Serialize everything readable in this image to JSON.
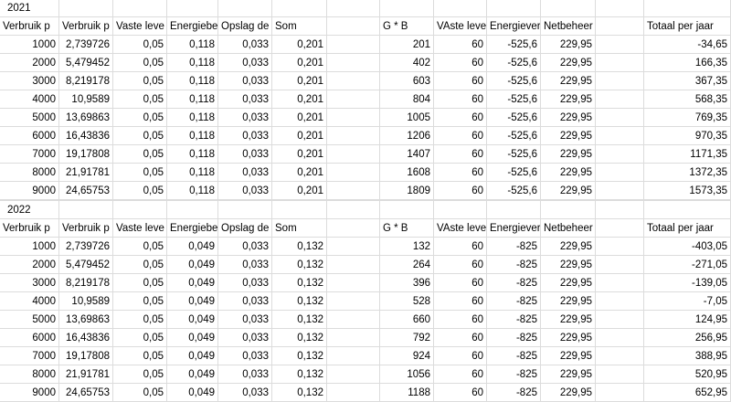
{
  "sections": [
    {
      "year": "2021",
      "headers": [
        "Verbruik p",
        "Verbruik p",
        "Vaste leve",
        "Energiebe",
        "Opslag de",
        "Som",
        "",
        "G * B",
        "VAste leve",
        "Energiever",
        "Netbeheer",
        "",
        "Totaal per jaar"
      ],
      "rows": [
        [
          "1000",
          "2,739726",
          "0,05",
          "0,118",
          "0,033",
          "0,201",
          "",
          "201",
          "60",
          "-525,6",
          "229,95",
          "",
          "-34,65"
        ],
        [
          "2000",
          "5,479452",
          "0,05",
          "0,118",
          "0,033",
          "0,201",
          "",
          "402",
          "60",
          "-525,6",
          "229,95",
          "",
          "166,35"
        ],
        [
          "3000",
          "8,219178",
          "0,05",
          "0,118",
          "0,033",
          "0,201",
          "",
          "603",
          "60",
          "-525,6",
          "229,95",
          "",
          "367,35"
        ],
        [
          "4000",
          "10,9589",
          "0,05",
          "0,118",
          "0,033",
          "0,201",
          "",
          "804",
          "60",
          "-525,6",
          "229,95",
          "",
          "568,35"
        ],
        [
          "5000",
          "13,69863",
          "0,05",
          "0,118",
          "0,033",
          "0,201",
          "",
          "1005",
          "60",
          "-525,6",
          "229,95",
          "",
          "769,35"
        ],
        [
          "6000",
          "16,43836",
          "0,05",
          "0,118",
          "0,033",
          "0,201",
          "",
          "1206",
          "60",
          "-525,6",
          "229,95",
          "",
          "970,35"
        ],
        [
          "7000",
          "19,17808",
          "0,05",
          "0,118",
          "0,033",
          "0,201",
          "",
          "1407",
          "60",
          "-525,6",
          "229,95",
          "",
          "1171,35"
        ],
        [
          "8000",
          "21,91781",
          "0,05",
          "0,118",
          "0,033",
          "0,201",
          "",
          "1608",
          "60",
          "-525,6",
          "229,95",
          "",
          "1372,35"
        ],
        [
          "9000",
          "24,65753",
          "0,05",
          "0,118",
          "0,033",
          "0,201",
          "",
          "1809",
          "60",
          "-525,6",
          "229,95",
          "",
          "1573,35"
        ]
      ]
    },
    {
      "year": "2022",
      "headers": [
        "Verbruik p",
        "Verbruik p",
        "Vaste leve",
        "Energiebe",
        "Opslag de",
        "Som",
        "",
        "G * B",
        "VAste leve",
        "Energiever",
        "Netbeheer",
        "",
        "Totaal per jaar"
      ],
      "rows": [
        [
          "1000",
          "2,739726",
          "0,05",
          "0,049",
          "0,033",
          "0,132",
          "",
          "132",
          "60",
          "-825",
          "229,95",
          "",
          "-403,05"
        ],
        [
          "2000",
          "5,479452",
          "0,05",
          "0,049",
          "0,033",
          "0,132",
          "",
          "264",
          "60",
          "-825",
          "229,95",
          "",
          "-271,05"
        ],
        [
          "3000",
          "8,219178",
          "0,05",
          "0,049",
          "0,033",
          "0,132",
          "",
          "396",
          "60",
          "-825",
          "229,95",
          "",
          "-139,05"
        ],
        [
          "4000",
          "10,9589",
          "0,05",
          "0,049",
          "0,033",
          "0,132",
          "",
          "528",
          "60",
          "-825",
          "229,95",
          "",
          "-7,05"
        ],
        [
          "5000",
          "13,69863",
          "0,05",
          "0,049",
          "0,033",
          "0,132",
          "",
          "660",
          "60",
          "-825",
          "229,95",
          "",
          "124,95"
        ],
        [
          "6000",
          "16,43836",
          "0,05",
          "0,049",
          "0,033",
          "0,132",
          "",
          "792",
          "60",
          "-825",
          "229,95",
          "",
          "256,95"
        ],
        [
          "7000",
          "19,17808",
          "0,05",
          "0,049",
          "0,033",
          "0,132",
          "",
          "924",
          "60",
          "-825",
          "229,95",
          "",
          "388,95"
        ],
        [
          "8000",
          "21,91781",
          "0,05",
          "0,049",
          "0,033",
          "0,132",
          "",
          "1056",
          "60",
          "-825",
          "229,95",
          "",
          "520,95"
        ],
        [
          "9000",
          "24,65753",
          "0,05",
          "0,049",
          "0,033",
          "0,132",
          "",
          "1188",
          "60",
          "-825",
          "229,95",
          "",
          "652,95"
        ]
      ]
    }
  ]
}
